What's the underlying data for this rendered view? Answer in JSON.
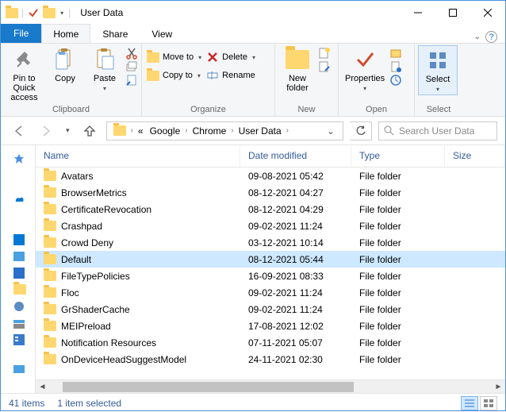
{
  "window": {
    "title": "User Data"
  },
  "tabs": {
    "file": "File",
    "home": "Home",
    "share": "Share",
    "view": "View"
  },
  "ribbon": {
    "clipboard": {
      "label": "Clipboard",
      "pin": "Pin to Quick\naccess",
      "copy": "Copy",
      "paste": "Paste"
    },
    "organize": {
      "label": "Organize",
      "move": "Move to",
      "copy": "Copy to",
      "delete": "Delete",
      "rename": "Rename"
    },
    "new": {
      "label": "New",
      "newfolder": "New\nfolder"
    },
    "open": {
      "label": "Open",
      "properties": "Properties"
    },
    "select": {
      "label": "Select",
      "select": "Select"
    }
  },
  "breadcrumb": [
    "Google",
    "Chrome",
    "User Data"
  ],
  "search": {
    "placeholder": "Search User Data"
  },
  "columns": {
    "name": "Name",
    "date": "Date modified",
    "type": "Type",
    "size": "Size"
  },
  "type_folder": "File folder",
  "rows": [
    {
      "name": "Avatars",
      "date": "09-08-2021 05:42",
      "sel": false
    },
    {
      "name": "BrowserMetrics",
      "date": "08-12-2021 04:27",
      "sel": false
    },
    {
      "name": "CertificateRevocation",
      "date": "08-12-2021 04:29",
      "sel": false
    },
    {
      "name": "Crashpad",
      "date": "09-02-2021 11:24",
      "sel": false
    },
    {
      "name": "Crowd Deny",
      "date": "03-12-2021 10:14",
      "sel": false
    },
    {
      "name": "Default",
      "date": "08-12-2021 05:44",
      "sel": true
    },
    {
      "name": "FileTypePolicies",
      "date": "16-09-2021 08:33",
      "sel": false
    },
    {
      "name": "Floc",
      "date": "09-02-2021 11:24",
      "sel": false
    },
    {
      "name": "GrShaderCache",
      "date": "09-02-2021 11:24",
      "sel": false
    },
    {
      "name": "MEIPreload",
      "date": "17-08-2021 12:02",
      "sel": false
    },
    {
      "name": "Notification Resources",
      "date": "07-11-2021 05:07",
      "sel": false
    },
    {
      "name": "OnDeviceHeadSuggestModel",
      "date": "24-11-2021 02:30",
      "sel": false
    }
  ],
  "status": {
    "items": "41 items",
    "selected": "1 item selected"
  }
}
